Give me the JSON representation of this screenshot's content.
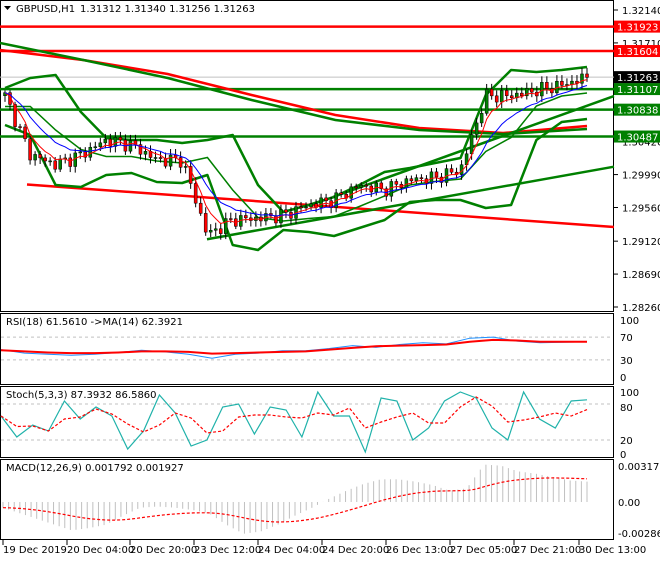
{
  "header": {
    "symbol_label": "GBPUSD,H1",
    "ohlc": "1.31312 1.31340 1.31256 1.31263"
  },
  "colors": {
    "bull": "#008000",
    "bear": "#ff0000",
    "level_red": "#ff0000",
    "level_green": "#008000",
    "current": "#000000",
    "rsi": "#1e90ff",
    "stoch": "#20b2aa"
  },
  "chart_data": [
    {
      "type": "candlestick",
      "title": "GBPUSD,H1",
      "ylim": [
        1.2826,
        1.3214
      ],
      "y_ticks": [
        "1.32140",
        "1.31710",
        "1.31280",
        "1.30420",
        "1.29990",
        "1.29560",
        "1.29120",
        "1.28690",
        "1.28260"
      ],
      "y_tick_values": [
        1.3214,
        1.3171,
        1.3128,
        1.3042,
        1.2999,
        1.2956,
        1.2912,
        1.2869,
        1.2826
      ],
      "x_ticks": [
        "19 Dec 2019",
        "20 Dec 04:00",
        "20 Dec 20:00",
        "23 Dec 12:00",
        "24 Dec 04:00",
        "24 Dec 20:00",
        "26 Dec 13:00",
        "27 Dec 05:00",
        "27 Dec 21:00",
        "30 Dec 13:00"
      ],
      "closes": [
        1.3102,
        1.3025,
        1.3012,
        1.3025,
        1.3044,
        1.3038,
        1.3018,
        1.3018,
        1.292,
        1.294,
        1.2942,
        1.2946,
        1.2959,
        1.2966,
        1.2985,
        1.2979,
        1.2992,
        1.2995,
        1.3005,
        1.3102,
        1.3102,
        1.3109,
        1.3116,
        1.3126
      ],
      "bb_upper": [
        1.31121,
        1.31252,
        1.31291,
        1.30807,
        1.30468,
        1.30442,
        1.30442,
        1.30402,
        1.30442,
        1.30507,
        1.29854,
        1.29501,
        1.29593,
        1.29697,
        1.29854,
        1.30024,
        1.30076,
        1.30141,
        1.30207,
        1.3103,
        1.31356,
        1.3133,
        1.31356,
        1.31395
      ],
      "bb_lower": [
        1.30638,
        1.30507,
        1.29854,
        1.29828,
        1.29984,
        1.30011,
        1.29893,
        1.2988,
        1.29984,
        1.2907,
        1.29005,
        1.29266,
        1.2924,
        1.29188,
        1.29292,
        1.29397,
        1.29632,
        1.29658,
        1.29658,
        1.29553,
        1.29593,
        1.30442,
        1.30677,
        1.30716
      ],
      "ma_long_red": [
        1.31617,
        1.31486,
        1.31304,
        1.31029,
        1.30768,
        1.30598,
        1.30533,
        1.30624
      ],
      "ma_long_green": [
        1.31709,
        1.31486,
        1.31252,
        1.30964,
        1.30703,
        1.30572,
        1.3052,
        1.30585
      ],
      "trendlines": {
        "red_lower": [
          1.2986,
          1.29305
        ],
        "green_lower": [
          1.29145,
          1.30093
        ],
        "green_upper": [
          1.29697,
          1.31016
        ]
      },
      "levels": [
        {
          "label": "1.31923",
          "value": 1.31923,
          "color": "red"
        },
        {
          "label": "1.31604",
          "value": 1.31604,
          "color": "red"
        },
        {
          "label": "1.31107",
          "value": 1.31107,
          "color": "green"
        },
        {
          "label": "1.30838",
          "value": 1.30838,
          "color": "green"
        },
        {
          "label": "1.30487",
          "value": 1.30487,
          "color": "green"
        }
      ],
      "current_price": {
        "label": "1.31263",
        "value": 1.31263
      }
    },
    {
      "type": "line",
      "title": "RSI(18) 61.5610  ->MA(14) 62.3921",
      "ylim": [
        0,
        100
      ],
      "y_ticks": [
        "100",
        "70",
        "30",
        "0"
      ],
      "levels": [
        70,
        30
      ],
      "rsi": [
        48,
        42,
        40,
        38,
        40,
        43,
        47,
        44,
        40,
        33,
        40,
        42,
        46,
        46,
        50,
        55,
        52,
        57,
        60,
        58,
        68,
        70,
        63,
        60,
        61,
        62
      ],
      "ma": [
        47,
        45,
        43,
        42,
        42,
        43,
        45,
        45,
        44,
        41,
        42,
        43,
        44,
        45,
        48,
        51,
        54,
        55,
        56,
        57,
        62,
        65,
        64,
        62,
        62,
        62
      ]
    },
    {
      "type": "line",
      "title": "Stoch(5,3,3) 87.3932 86.5860",
      "ylim": [
        0,
        100
      ],
      "y_ticks": [
        "100",
        "80",
        "20",
        "0"
      ],
      "levels": [
        80,
        20
      ],
      "k": [
        60,
        25,
        45,
        35,
        85,
        55,
        75,
        60,
        5,
        35,
        95,
        65,
        10,
        20,
        75,
        80,
        30,
        75,
        70,
        25,
        100,
        60,
        60,
        0,
        90,
        85,
        20,
        40,
        85,
        100,
        90,
        40,
        20,
        100,
        55,
        40,
        85,
        87
      ]
    },
    {
      "type": "bar",
      "title": "MACD(12,26,9) 0.001792 0.001927",
      "ylim": [
        -0.002861,
        0.003173
      ],
      "y_ticks": [
        "0.003173",
        "0.00",
        "-0.002861"
      ],
      "histogram": [
        -0.0005,
        -0.001,
        -0.0015,
        -0.002,
        -0.0025,
        -0.0023,
        -0.002,
        -0.0012,
        -0.0005,
        -0.0004,
        -0.0005,
        -0.0007,
        -0.001,
        -0.002,
        -0.0028,
        -0.0026,
        -0.002,
        -0.0012,
        -0.0005,
        0.0003,
        0.001,
        0.0016,
        0.002,
        0.002,
        0.0018,
        0.0015,
        0.001,
        0.0012,
        0.0033,
        0.0032,
        0.0027,
        0.0025,
        0.0022,
        0.0019,
        0.0018
      ]
    }
  ]
}
